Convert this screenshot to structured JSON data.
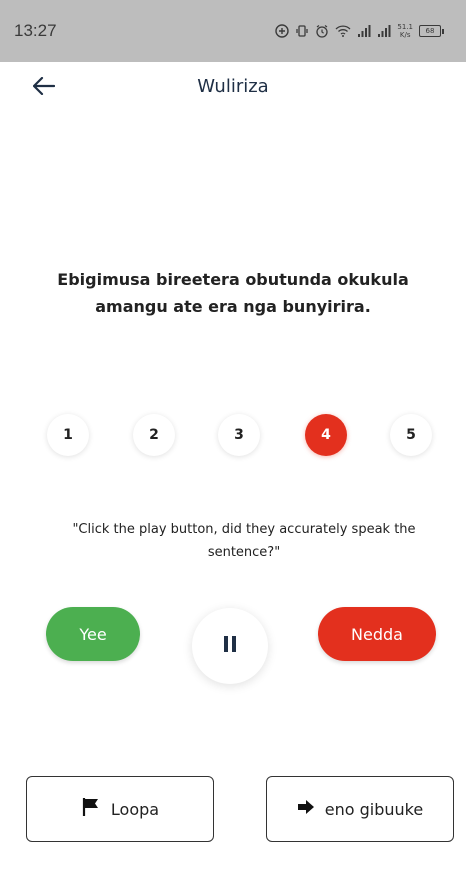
{
  "status_bar": {
    "time": "13:27",
    "icons": [
      "add-circle-icon",
      "vibrate-icon",
      "alarm-icon",
      "wifi-icon",
      "signal-icon",
      "signal-icon",
      "data-speed-icon",
      "battery-icon"
    ],
    "data_speed_value": "51.1",
    "data_speed_unit": "K/s",
    "battery_level": "68"
  },
  "app_bar": {
    "back_icon": "arrow-left-icon",
    "title": "Wuliriza"
  },
  "sentence": "Ebigimusa bireetera obutunda okukula amangu ate era nga bunyirira.",
  "rating": {
    "options": [
      "1",
      "2",
      "3",
      "4",
      "5"
    ],
    "selected": "4",
    "selected_color": "#e3301e"
  },
  "question": "\"Click the play button, did they accurately speak the sentence?\"",
  "controls": {
    "yes_label": "Yee",
    "yes_color": "#4caf50",
    "no_label": "Nedda",
    "no_color": "#e3301e",
    "play_state_icon": "pause-icon"
  },
  "footer": {
    "report_icon": "flag-icon",
    "report_label": "Loopa",
    "skip_icon": "arrow-right-icon",
    "skip_label": "eno gibuuke"
  }
}
